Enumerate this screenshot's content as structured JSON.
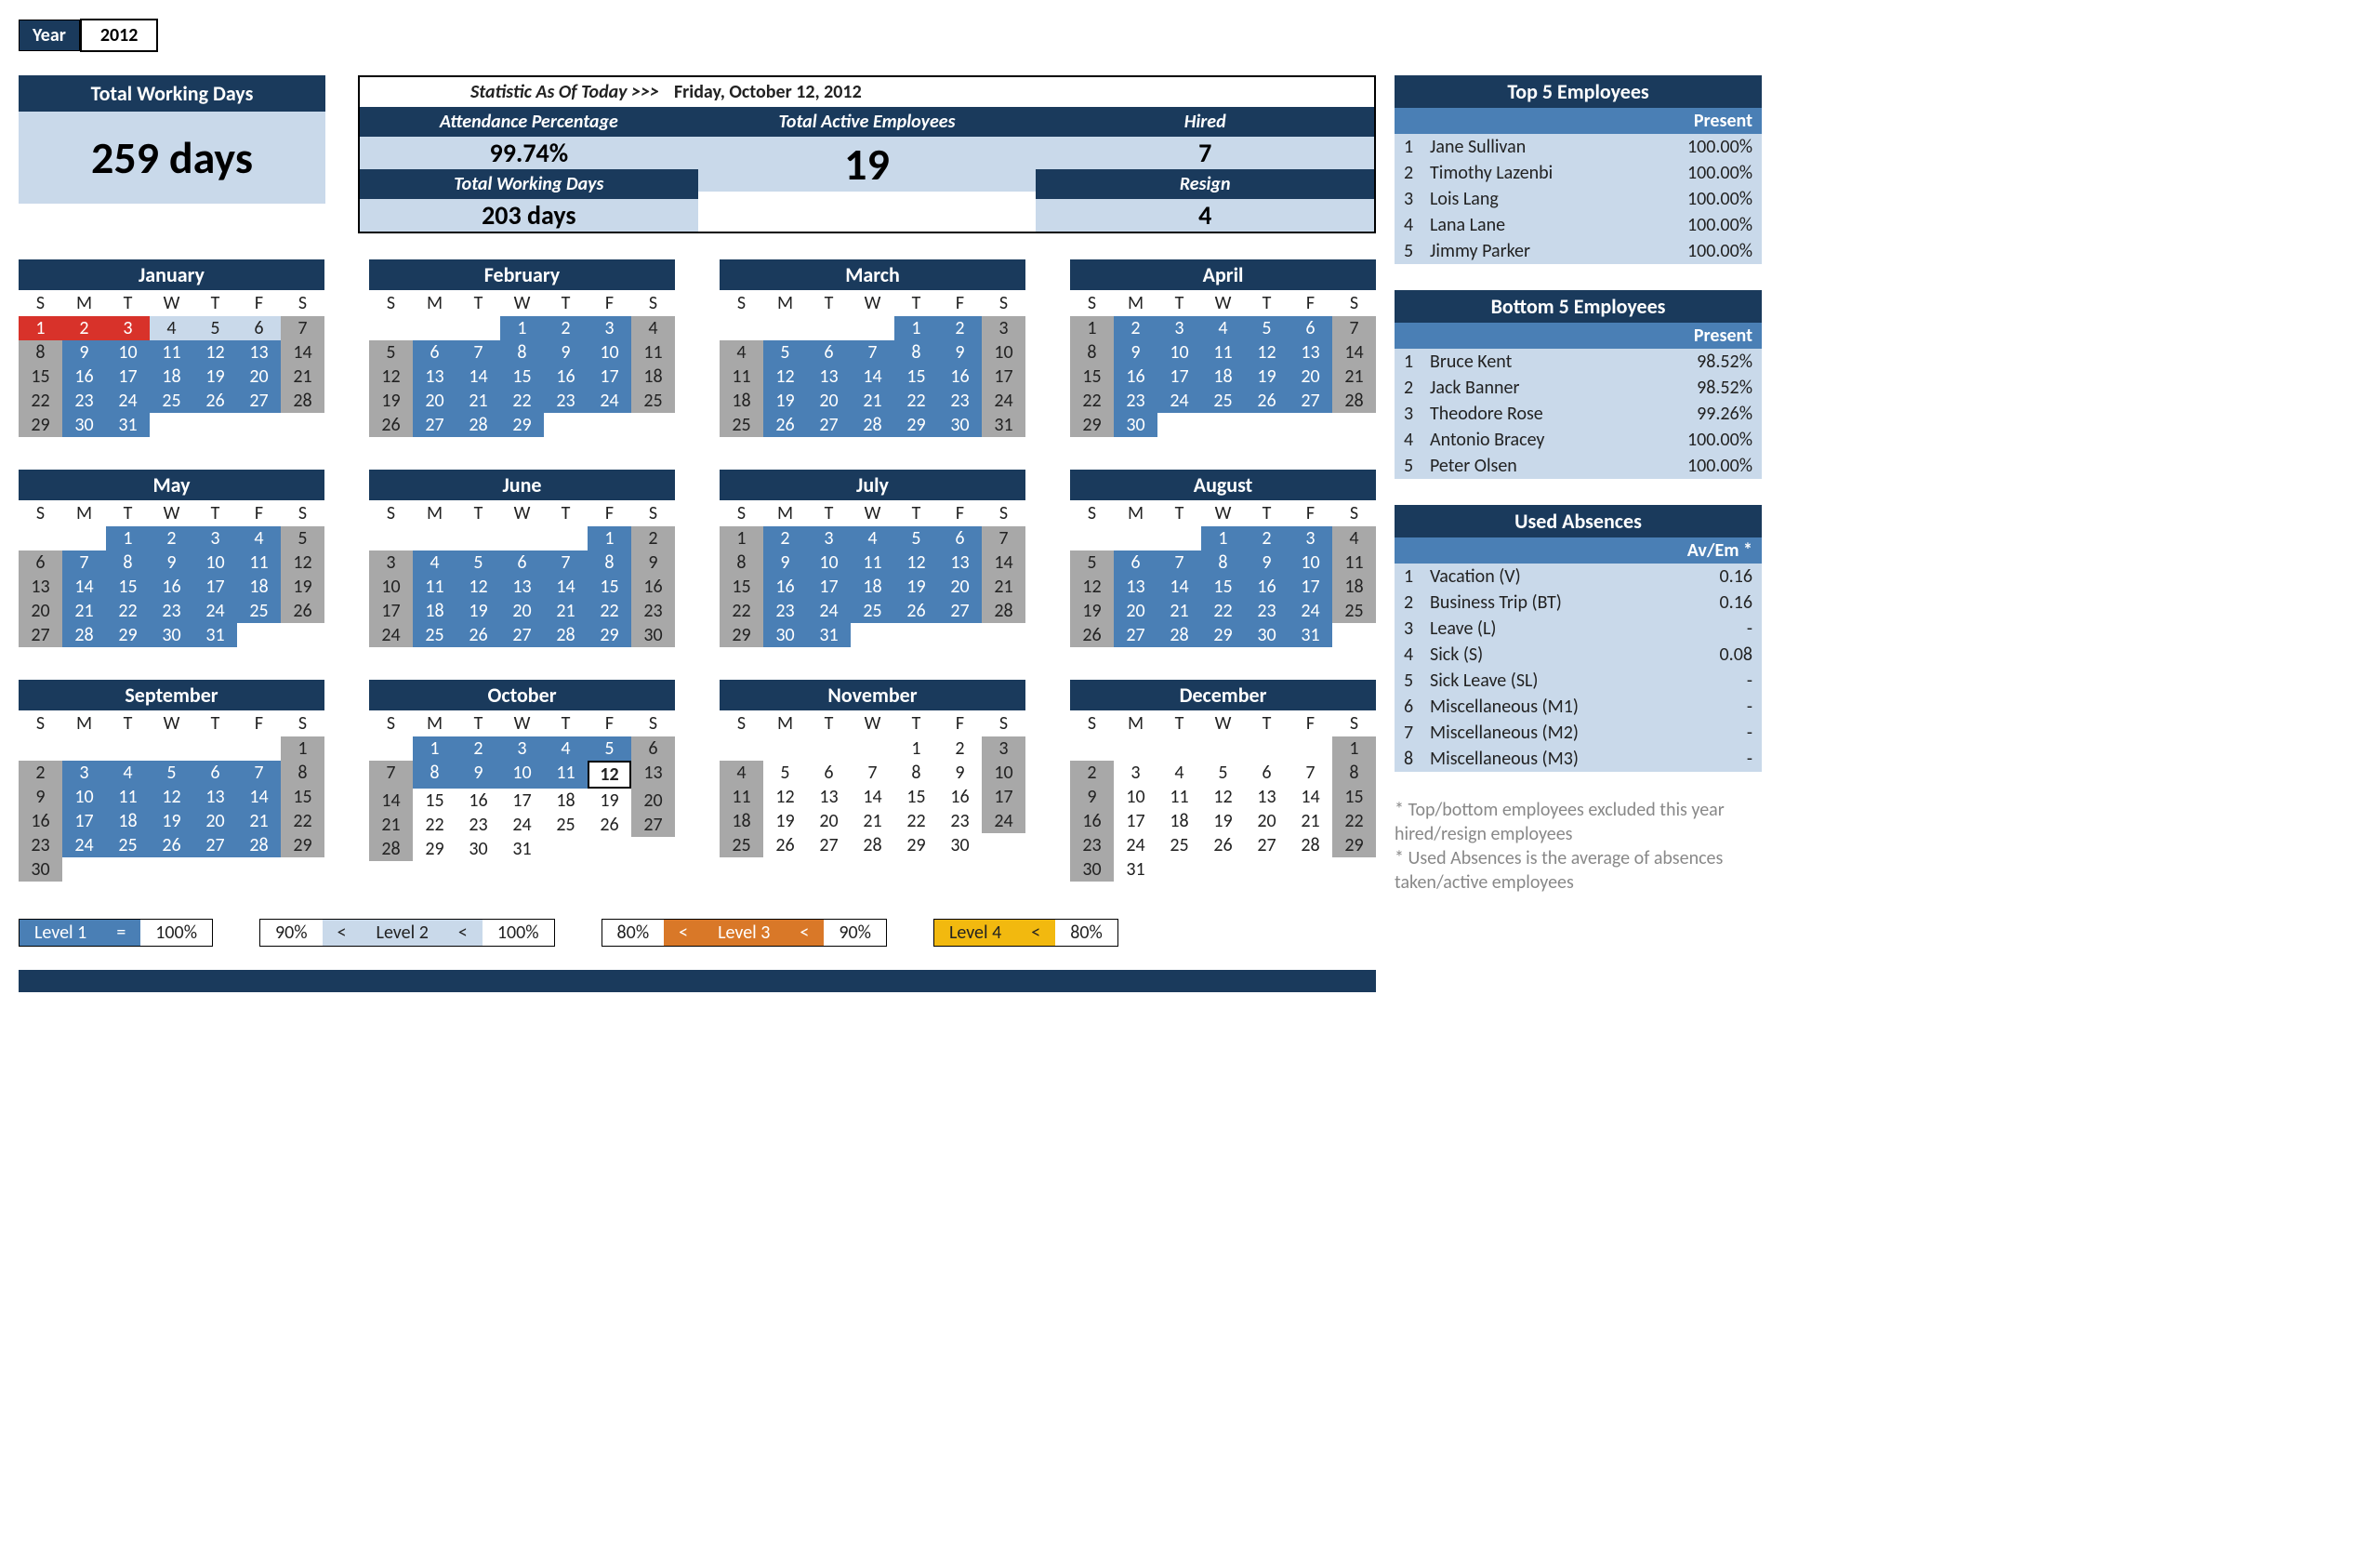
{
  "year": {
    "label": "Year",
    "value": "2012"
  },
  "twd": {
    "title": "Total Working Days",
    "value": "259 days"
  },
  "stats_panel": {
    "as_of_label": "Statistic As Of Today   >>>",
    "date": "Friday, October 12, 2012",
    "cols": [
      [
        {
          "title": "Attendance Percentage",
          "value": "99.74%"
        },
        {
          "title": "Total Working Days",
          "value": "203 days"
        }
      ],
      [
        {
          "title": "Total Active Employees",
          "value": "19",
          "big": true
        }
      ],
      [
        {
          "title": "Hired",
          "value": "7"
        },
        {
          "title": "Resign",
          "value": "4"
        }
      ]
    ]
  },
  "dow": [
    "S",
    "M",
    "T",
    "W",
    "T",
    "F",
    "S"
  ],
  "months": [
    {
      "name": "January",
      "start": 0,
      "days": 31,
      "styles": {
        "1": "red",
        "2": "red",
        "3": "red",
        "4": "lt",
        "5": "lt",
        "6": "lt",
        "7": "gray",
        "8": "gray",
        "9": "blue",
        "10": "blue",
        "11": "blue",
        "12": "blue",
        "13": "blue",
        "14": "gray",
        "15": "gray",
        "16": "blue",
        "17": "blue",
        "18": "blue",
        "19": "blue",
        "20": "blue",
        "21": "gray",
        "22": "gray",
        "23": "blue",
        "24": "blue",
        "25": "blue",
        "26": "blue",
        "27": "blue",
        "28": "gray",
        "29": "gray",
        "30": "blue",
        "31": "blue"
      }
    },
    {
      "name": "February",
      "start": 3,
      "days": 29,
      "styles": {
        "1": "blue",
        "2": "blue",
        "3": "blue",
        "4": "gray",
        "5": "gray",
        "6": "blue",
        "7": "blue",
        "8": "blue",
        "9": "blue",
        "10": "blue",
        "11": "gray",
        "12": "gray",
        "13": "blue",
        "14": "blue",
        "15": "blue",
        "16": "blue",
        "17": "blue",
        "18": "gray",
        "19": "gray",
        "20": "blue",
        "21": "blue",
        "22": "blue",
        "23": "blue",
        "24": "blue",
        "25": "gray",
        "26": "gray",
        "27": "blue",
        "28": "blue",
        "29": "blue"
      }
    },
    {
      "name": "March",
      "start": 4,
      "days": 31,
      "styles": {
        "1": "blue",
        "2": "blue",
        "3": "gray",
        "4": "gray",
        "5": "blue",
        "6": "blue",
        "7": "blue",
        "8": "blue",
        "9": "blue",
        "10": "gray",
        "11": "gray",
        "12": "blue",
        "13": "blue",
        "14": "blue",
        "15": "blue",
        "16": "blue",
        "17": "gray",
        "18": "gray",
        "19": "blue",
        "20": "blue",
        "21": "blue",
        "22": "blue",
        "23": "blue",
        "24": "gray",
        "25": "gray",
        "26": "blue",
        "27": "blue",
        "28": "blue",
        "29": "blue",
        "30": "blue",
        "31": "gray"
      }
    },
    {
      "name": "April",
      "start": 0,
      "days": 30,
      "styles": {
        "1": "gray",
        "2": "blue",
        "3": "blue",
        "4": "blue",
        "5": "blue",
        "6": "blue",
        "7": "gray",
        "8": "gray",
        "9": "blue",
        "10": "blue",
        "11": "blue",
        "12": "blue",
        "13": "blue",
        "14": "gray",
        "15": "gray",
        "16": "blue",
        "17": "blue",
        "18": "blue",
        "19": "blue",
        "20": "blue",
        "21": "gray",
        "22": "gray",
        "23": "blue",
        "24": "blue",
        "25": "blue",
        "26": "blue",
        "27": "blue",
        "28": "gray",
        "29": "gray",
        "30": "blue"
      }
    },
    {
      "name": "May",
      "start": 2,
      "days": 31,
      "styles": {
        "1": "blue",
        "2": "blue",
        "3": "blue",
        "4": "blue",
        "5": "gray",
        "6": "gray",
        "7": "blue",
        "8": "blue",
        "9": "blue",
        "10": "blue",
        "11": "blue",
        "12": "gray",
        "13": "gray",
        "14": "blue",
        "15": "blue",
        "16": "blue",
        "17": "blue",
        "18": "blue",
        "19": "gray",
        "20": "gray",
        "21": "blue",
        "22": "blue",
        "23": "blue",
        "24": "blue",
        "25": "blue",
        "26": "gray",
        "27": "gray",
        "28": "blue",
        "29": "blue",
        "30": "blue",
        "31": "blue"
      }
    },
    {
      "name": "June",
      "start": 5,
      "days": 30,
      "styles": {
        "1": "blue",
        "2": "gray",
        "3": "gray",
        "4": "blue",
        "5": "blue",
        "6": "blue",
        "7": "blue",
        "8": "blue",
        "9": "gray",
        "10": "gray",
        "11": "blue",
        "12": "blue",
        "13": "blue",
        "14": "blue",
        "15": "blue",
        "16": "gray",
        "17": "gray",
        "18": "blue",
        "19": "blue",
        "20": "blue",
        "21": "blue",
        "22": "blue",
        "23": "gray",
        "24": "gray",
        "25": "blue",
        "26": "blue",
        "27": "blue",
        "28": "blue",
        "29": "blue",
        "30": "gray"
      }
    },
    {
      "name": "July",
      "start": 0,
      "days": 31,
      "styles": {
        "1": "gray",
        "2": "blue",
        "3": "blue",
        "4": "blue",
        "5": "blue",
        "6": "blue",
        "7": "gray",
        "8": "gray",
        "9": "blue",
        "10": "blue",
        "11": "blue",
        "12": "blue",
        "13": "blue",
        "14": "gray",
        "15": "gray",
        "16": "blue",
        "17": "blue",
        "18": "blue",
        "19": "blue",
        "20": "blue",
        "21": "gray",
        "22": "gray",
        "23": "blue",
        "24": "blue",
        "25": "blue",
        "26": "blue",
        "27": "blue",
        "28": "gray",
        "29": "gray",
        "30": "blue",
        "31": "blue"
      }
    },
    {
      "name": "August",
      "start": 3,
      "days": 31,
      "styles": {
        "1": "blue",
        "2": "blue",
        "3": "blue",
        "4": "gray",
        "5": "gray",
        "6": "blue",
        "7": "blue",
        "8": "blue",
        "9": "blue",
        "10": "blue",
        "11": "gray",
        "12": "gray",
        "13": "blue",
        "14": "blue",
        "15": "blue",
        "16": "blue",
        "17": "blue",
        "18": "gray",
        "19": "gray",
        "20": "blue",
        "21": "blue",
        "22": "blue",
        "23": "blue",
        "24": "blue",
        "25": "gray",
        "26": "gray",
        "27": "blue",
        "28": "blue",
        "29": "blue",
        "30": "blue",
        "31": "blue"
      }
    },
    {
      "name": "September",
      "start": 6,
      "days": 30,
      "styles": {
        "1": "gray",
        "2": "gray",
        "3": "blue",
        "4": "blue",
        "5": "blue",
        "6": "blue",
        "7": "blue",
        "8": "gray",
        "9": "gray",
        "10": "blue",
        "11": "blue",
        "12": "blue",
        "13": "blue",
        "14": "blue",
        "15": "gray",
        "16": "gray",
        "17": "blue",
        "18": "blue",
        "19": "blue",
        "20": "blue",
        "21": "blue",
        "22": "gray",
        "23": "gray",
        "24": "blue",
        "25": "blue",
        "26": "blue",
        "27": "blue",
        "28": "blue",
        "29": "gray",
        "30": "gray"
      }
    },
    {
      "name": "October",
      "start": 1,
      "days": 31,
      "styles": {
        "1": "blue",
        "2": "blue",
        "3": "blue",
        "4": "blue",
        "5": "blue",
        "6": "gray",
        "7": "gray",
        "8": "blue",
        "9": "blue",
        "10": "blue",
        "11": "blue",
        "12": "today",
        "13": "gray",
        "14": "gray",
        "15": "white",
        "16": "white",
        "17": "white",
        "18": "white",
        "19": "white",
        "20": "gray",
        "21": "gray",
        "22": "white",
        "23": "white",
        "24": "white",
        "25": "white",
        "26": "white",
        "27": "gray",
        "28": "gray",
        "29": "white",
        "30": "white",
        "31": "white"
      }
    },
    {
      "name": "November",
      "start": 4,
      "days": 30,
      "styles": {
        "1": "white",
        "2": "white",
        "3": "gray",
        "4": "gray",
        "5": "white",
        "6": "white",
        "7": "white",
        "8": "white",
        "9": "white",
        "10": "gray",
        "11": "gray",
        "12": "white",
        "13": "white",
        "14": "white",
        "15": "white",
        "16": "white",
        "17": "gray",
        "18": "gray",
        "19": "white",
        "20": "white",
        "21": "white",
        "22": "white",
        "23": "white",
        "24": "gray",
        "25": "gray",
        "26": "white",
        "27": "white",
        "28": "white",
        "29": "white",
        "30": "white"
      }
    },
    {
      "name": "December",
      "start": 6,
      "days": 31,
      "styles": {
        "1": "gray",
        "2": "gray",
        "3": "white",
        "4": "white",
        "5": "white",
        "6": "white",
        "7": "white",
        "8": "gray",
        "9": "gray",
        "10": "white",
        "11": "white",
        "12": "white",
        "13": "white",
        "14": "white",
        "15": "gray",
        "16": "gray",
        "17": "white",
        "18": "white",
        "19": "white",
        "20": "white",
        "21": "white",
        "22": "gray",
        "23": "gray",
        "24": "white",
        "25": "white",
        "26": "white",
        "27": "white",
        "28": "white",
        "29": "gray",
        "30": "gray",
        "31": "white"
      }
    }
  ],
  "top5": {
    "title": "Top 5 Employees",
    "sub": "Present",
    "rows": [
      {
        "idx": "1",
        "name": "Jane Sullivan",
        "val": "100.00%"
      },
      {
        "idx": "2",
        "name": "Timothy Lazenbi",
        "val": "100.00%"
      },
      {
        "idx": "3",
        "name": "Lois Lang",
        "val": "100.00%"
      },
      {
        "idx": "4",
        "name": "Lana Lane",
        "val": "100.00%"
      },
      {
        "idx": "5",
        "name": "Jimmy Parker",
        "val": "100.00%"
      }
    ]
  },
  "bottom5": {
    "title": "Bottom 5 Employees",
    "sub": "Present",
    "rows": [
      {
        "idx": "1",
        "name": "Bruce Kent",
        "val": "98.52%"
      },
      {
        "idx": "2",
        "name": "Jack Banner",
        "val": "98.52%"
      },
      {
        "idx": "3",
        "name": "Theodore Rose",
        "val": "99.26%"
      },
      {
        "idx": "4",
        "name": "Antonio Bracey",
        "val": "100.00%"
      },
      {
        "idx": "5",
        "name": "Peter Olsen",
        "val": "100.00%"
      }
    ]
  },
  "absences": {
    "title": "Used Absences",
    "sub": "Av/Em *",
    "rows": [
      {
        "idx": "1",
        "name": "Vacation (V)",
        "val": "0.16"
      },
      {
        "idx": "2",
        "name": "Business Trip (BT)",
        "val": "0.16"
      },
      {
        "idx": "3",
        "name": "Leave (L)",
        "val": "-"
      },
      {
        "idx": "4",
        "name": "Sick (S)",
        "val": "0.08"
      },
      {
        "idx": "5",
        "name": "Sick Leave (SL)",
        "val": "-"
      },
      {
        "idx": "6",
        "name": "Miscellaneous (M1)",
        "val": "-"
      },
      {
        "idx": "7",
        "name": "Miscellaneous (M2)",
        "val": "-"
      },
      {
        "idx": "8",
        "name": "Miscellaneous (M3)",
        "val": "-"
      }
    ]
  },
  "footnotes": [
    "* Top/bottom employees excluded this year hired/resign employees",
    "* Used Absences is the average of absences taken/active employees"
  ],
  "legend": [
    {
      "color": "blue",
      "label": "Level 1",
      "op": "=",
      "v1": "",
      "v2": "100%"
    },
    {
      "color": "lt",
      "label": "Level 2",
      "op": "<",
      "v1": "90%",
      "v2": "100%"
    },
    {
      "color": "or",
      "label": "Level 3",
      "op": "<",
      "v1": "80%",
      "v2": "90%"
    },
    {
      "color": "yl",
      "label": "Level 4",
      "op": "<",
      "v1": "",
      "v2": "80%"
    }
  ]
}
